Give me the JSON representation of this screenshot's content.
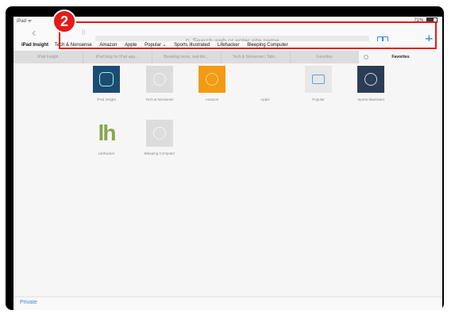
{
  "status": {
    "carrier": "iPad ᯤ",
    "battery": "71%"
  },
  "toolbar": {
    "back_glyph": "‹",
    "fwd_fragment": "⌷",
    "search_placeholder": "Search web or enter site name",
    "search_icon": "search-icon",
    "plus_glyph": "+",
    "cloud_glyph": "☁"
  },
  "bookmarks": [
    "iPad Insight",
    "Tech & Nonsense",
    "Amazon",
    "Apple",
    "Popular ⌄",
    "Sports Illustrated",
    "Lifehacker",
    "Bleeping Computer"
  ],
  "tabs": [
    "iPad Insight",
    "iPad blog for iPad app...",
    "Breaking news, real-tim...",
    "Tech & Nonsense | Talki...",
    "Favorites",
    "Favorites"
  ],
  "favorites": [
    {
      "label": "iPad Insight",
      "icon": "ipad-insight-icon"
    },
    {
      "label": "Tech & Nonsense",
      "icon": "compass-icon"
    },
    {
      "label": "Amazon",
      "icon": "compass-icon"
    },
    {
      "label": "Apple",
      "icon": "apple-icon",
      "glyph": ""
    },
    {
      "label": "Popular",
      "icon": "folder-icon"
    },
    {
      "label": "Sports Illustrated",
      "icon": "compass-icon"
    },
    {
      "label": "Lifehacker",
      "icon": "lifehacker-icon",
      "glyph": "lh"
    },
    {
      "label": "Bleeping Computer",
      "icon": "compass-icon"
    }
  ],
  "bottom": {
    "private_label": "Private"
  },
  "annotation": {
    "step_number": "2"
  },
  "colors": {
    "accent": "#3b86d6",
    "highlight": "#e31a1a"
  }
}
